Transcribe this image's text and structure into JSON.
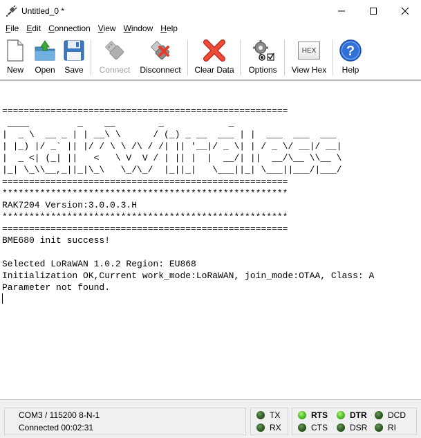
{
  "window": {
    "title": "Untitled_0 *",
    "icon": "plug-icon",
    "controls": [
      "minimize-icon",
      "maximize-icon",
      "close-icon"
    ]
  },
  "menu": {
    "items": [
      {
        "first": "F",
        "rest": "ile"
      },
      {
        "first": "E",
        "rest": "dit"
      },
      {
        "first": "C",
        "rest": "onnection"
      },
      {
        "first": "V",
        "rest": "iew"
      },
      {
        "first": "W",
        "rest": "indow"
      },
      {
        "first": "H",
        "rest": "elp"
      }
    ]
  },
  "toolbar": {
    "new": "New",
    "open": "Open",
    "save": "Save",
    "connect": "Connect",
    "disconnect": "Disconnect",
    "clear_data": "Clear Data",
    "options": "Options",
    "view_hex": "View Hex",
    "hex_badge": "HEX",
    "help": "Help"
  },
  "terminal": {
    "lines": [
      "",
      "=====================================================",
      " ____         _    __        _            _ ",
      "|  _ \\  __ _ | | __\\ \\      / (_) _ __  ___ | |  ___  ___  ___ ",
      "| |_) |/ _` || |/ / \\ \\ /\\ / /| || '__|/ _ \\| | / _ \\/ __|/ __|",
      "|  _ <| (_| ||   <   \\ V  V / | || |  |  __/| ||  __/\\__ \\\\__ \\",
      "|_| \\_\\\\__,_||_|\\_\\   \\_/\\_/  |_||_|   \\___||_| \\___||___/|___/",
      "=====================================================",
      "*****************************************************",
      "RAK7204 Version:3.0.0.3.H",
      "*****************************************************",
      "=====================================================",
      "BME680 init success!",
      "",
      "Selected LoRaWAN 1.0.2 Region: EU868",
      "Initialization OK,Current work_mode:LoRaWAN, join_mode:OTAA, Class: A",
      "Parameter not found."
    ]
  },
  "status": {
    "port": "COM3 / 115200 8-N-1",
    "connection": "Connected 00:02:31",
    "signals": {
      "tx": "TX",
      "rx": "RX",
      "rts": "RTS",
      "cts": "CTS",
      "dtr": "DTR",
      "dsr": "DSR",
      "dcd": "DCD",
      "ri": "RI"
    },
    "led_colors": {
      "on": "#58c42a",
      "off": "#2e5a22"
    }
  }
}
